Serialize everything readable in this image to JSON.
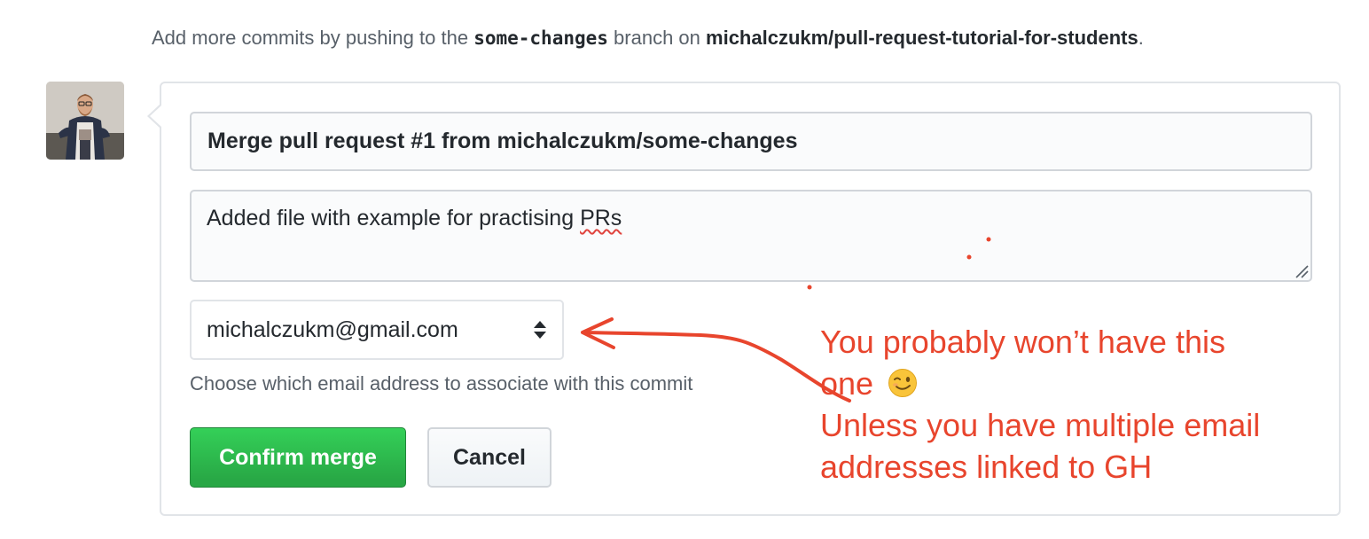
{
  "info": {
    "prefix": "Add more commits by pushing to the",
    "branch": "some-changes",
    "middle": "branch on",
    "repo": "michalczukm/pull-request-tutorial-for-students",
    "suffix": "."
  },
  "merge_form": {
    "title_value": "Merge pull request #1 from michalczukm/some-changes",
    "message_prefix": "Added file with example for practising",
    "message_misspelled": "PRs",
    "email_selected": "michalczukm@gmail.com",
    "email_note": "Choose which email address to associate with this commit",
    "confirm_label": "Confirm merge",
    "cancel_label": "Cancel"
  },
  "annotation": {
    "line1": "You probably won’t have this",
    "line2": "one",
    "line3": "Unless you have multiple email",
    "line4": "addresses linked to GH",
    "color": "#e8452d"
  },
  "colors": {
    "confirm_green": "#2cbe4e",
    "border_gray": "#e1e4e8",
    "muted_text": "#586069"
  },
  "icons": {
    "select_arrows": "up-down-caret-icon",
    "wink": "wink-emoji-icon",
    "resize": "resize-grip-icon"
  }
}
